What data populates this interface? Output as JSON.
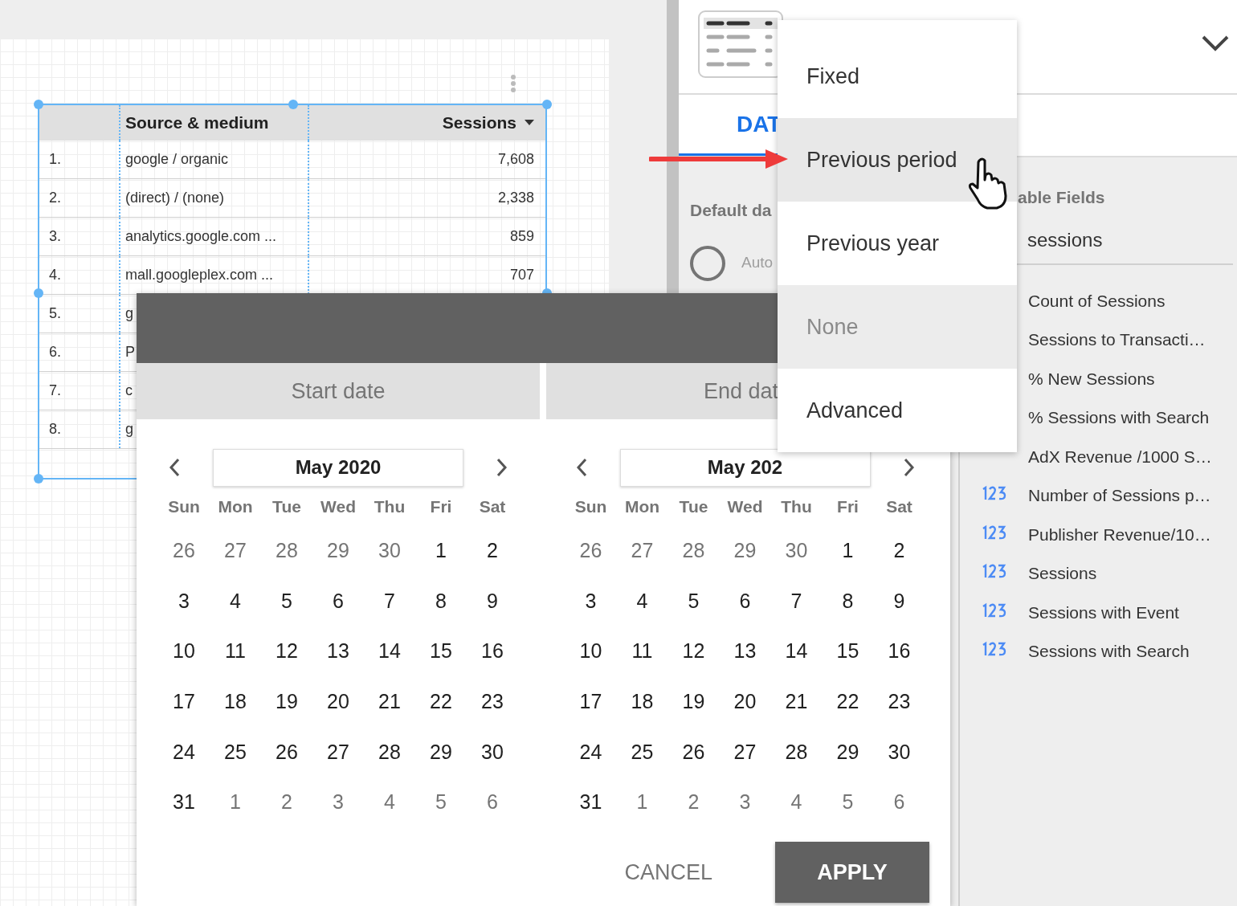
{
  "report_table": {
    "columns": [
      {
        "label": "Source & medium",
        "sorted": false
      },
      {
        "label": "Sessions",
        "sorted": true
      }
    ],
    "rows": [
      {
        "index": "1.",
        "source": "google / organic",
        "sessions": "7,608"
      },
      {
        "index": "2.",
        "source": "(direct) / (none)",
        "sessions": "2,338"
      },
      {
        "index": "3.",
        "source": "analytics.google.com ...",
        "sessions": "859"
      },
      {
        "index": "4.",
        "source": "mall.googleplex.com ...",
        "sessions": "707"
      },
      {
        "index": "5.",
        "source": "g"
      },
      {
        "index": "6.",
        "source": "P"
      },
      {
        "index": "7.",
        "source": "c"
      },
      {
        "index": "8.",
        "source": "g"
      }
    ]
  },
  "properties_panel": {
    "tab": {
      "label": "DAT",
      "selected": true
    },
    "default_date_label": "Default da",
    "radio": {
      "label": "Auto",
      "checked": false
    },
    "fields_heading": "able Fields",
    "search": {
      "value": "sessions"
    },
    "fields": [
      {
        "label": "Count of Sessions"
      },
      {
        "label": "Sessions to Transacti…"
      },
      {
        "label": "% New Sessions"
      },
      {
        "label": "% Sessions with Search"
      },
      {
        "label": "AdX Revenue /1000 S…"
      },
      {
        "label": "Number of Sessions p…",
        "icon_shown": true
      },
      {
        "label": "Publisher Revenue/10…",
        "icon_shown": true
      },
      {
        "label": "Sessions",
        "icon_shown": true
      },
      {
        "label": "Sessions with Event",
        "icon_shown": true
      },
      {
        "label": "Sessions with Search",
        "icon_shown": true
      }
    ]
  },
  "date_dialog": {
    "tabs": [
      {
        "label": "Start date"
      },
      {
        "label": "End dat"
      }
    ],
    "calendars": [
      {
        "month": "May 2020",
        "weekdays": [
          "Sun",
          "Mon",
          "Tue",
          "Wed",
          "Thu",
          "Fri",
          "Sat"
        ],
        "weeks": [
          [
            {
              "d": "26",
              "outside": true
            },
            {
              "d": "27",
              "outside": true
            },
            {
              "d": "28",
              "outside": true
            },
            {
              "d": "29",
              "outside": true
            },
            {
              "d": "30",
              "outside": true
            },
            {
              "d": "1",
              "outside": false
            },
            {
              "d": "2",
              "outside": false
            }
          ],
          [
            {
              "d": "3",
              "outside": false
            },
            {
              "d": "4",
              "outside": false
            },
            {
              "d": "5",
              "outside": false
            },
            {
              "d": "6",
              "outside": false
            },
            {
              "d": "7",
              "outside": false
            },
            {
              "d": "8",
              "outside": false
            },
            {
              "d": "9",
              "outside": false
            }
          ],
          [
            {
              "d": "10",
              "outside": false
            },
            {
              "d": "11",
              "outside": false
            },
            {
              "d": "12",
              "outside": false
            },
            {
              "d": "13",
              "outside": false
            },
            {
              "d": "14",
              "outside": false
            },
            {
              "d": "15",
              "outside": false
            },
            {
              "d": "16",
              "outside": false
            }
          ],
          [
            {
              "d": "17",
              "outside": false
            },
            {
              "d": "18",
              "outside": false
            },
            {
              "d": "19",
              "outside": false
            },
            {
              "d": "20",
              "outside": false
            },
            {
              "d": "21",
              "outside": false
            },
            {
              "d": "22",
              "outside": false
            },
            {
              "d": "23",
              "outside": false
            }
          ],
          [
            {
              "d": "24",
              "outside": false
            },
            {
              "d": "25",
              "outside": false
            },
            {
              "d": "26",
              "outside": false
            },
            {
              "d": "27",
              "outside": false
            },
            {
              "d": "28",
              "outside": false
            },
            {
              "d": "29",
              "outside": false
            },
            {
              "d": "30",
              "outside": false
            }
          ],
          [
            {
              "d": "31",
              "outside": false
            },
            {
              "d": "1",
              "outside": true
            },
            {
              "d": "2",
              "outside": true
            },
            {
              "d": "3",
              "outside": true
            },
            {
              "d": "4",
              "outside": true
            },
            {
              "d": "5",
              "outside": true
            },
            {
              "d": "6",
              "outside": true
            }
          ]
        ]
      },
      {
        "month": "May 202",
        "weekdays": [
          "Sun",
          "Mon",
          "Tue",
          "Wed",
          "Thu",
          "Fri",
          "Sat"
        ],
        "weeks": [
          [
            {
              "d": "26",
              "outside": true
            },
            {
              "d": "27",
              "outside": true
            },
            {
              "d": "28",
              "outside": true
            },
            {
              "d": "29",
              "outside": true
            },
            {
              "d": "30",
              "outside": true
            },
            {
              "d": "1",
              "outside": false
            },
            {
              "d": "2",
              "outside": false
            }
          ],
          [
            {
              "d": "3",
              "outside": false
            },
            {
              "d": "4",
              "outside": false
            },
            {
              "d": "5",
              "outside": false
            },
            {
              "d": "6",
              "outside": false
            },
            {
              "d": "7",
              "outside": false
            },
            {
              "d": "8",
              "outside": false
            },
            {
              "d": "9",
              "outside": false
            }
          ],
          [
            {
              "d": "10",
              "outside": false
            },
            {
              "d": "11",
              "outside": false
            },
            {
              "d": "12",
              "outside": false
            },
            {
              "d": "13",
              "outside": false
            },
            {
              "d": "14",
              "outside": false
            },
            {
              "d": "15",
              "outside": false
            },
            {
              "d": "16",
              "outside": false
            }
          ],
          [
            {
              "d": "17",
              "outside": false
            },
            {
              "d": "18",
              "outside": false
            },
            {
              "d": "19",
              "outside": false
            },
            {
              "d": "20",
              "outside": false
            },
            {
              "d": "21",
              "outside": false
            },
            {
              "d": "22",
              "outside": false
            },
            {
              "d": "23",
              "outside": false
            }
          ],
          [
            {
              "d": "24",
              "outside": false
            },
            {
              "d": "25",
              "outside": false
            },
            {
              "d": "26",
              "outside": false
            },
            {
              "d": "27",
              "outside": false
            },
            {
              "d": "28",
              "outside": false
            },
            {
              "d": "29",
              "outside": false
            },
            {
              "d": "30",
              "outside": false
            }
          ],
          [
            {
              "d": "31",
              "outside": false
            },
            {
              "d": "1",
              "outside": true
            },
            {
              "d": "2",
              "outside": true
            },
            {
              "d": "3",
              "outside": true
            },
            {
              "d": "4",
              "outside": true
            },
            {
              "d": "5",
              "outside": true
            },
            {
              "d": "6",
              "outside": true
            }
          ]
        ]
      }
    ],
    "buttons": [
      {
        "label": "CANCEL",
        "kind": "text"
      },
      {
        "label": "APPLY",
        "kind": "filled"
      }
    ]
  },
  "comparison_menu": {
    "items": [
      {
        "label": "Fixed",
        "hovered": false,
        "selected": false
      },
      {
        "label": "Previous period",
        "hovered": true,
        "selected": false
      },
      {
        "label": "Previous year",
        "hovered": false,
        "selected": false
      },
      {
        "label": "None",
        "hovered": false,
        "selected": true
      },
      {
        "label": "Advanced",
        "hovered": false,
        "selected": false
      }
    ]
  }
}
